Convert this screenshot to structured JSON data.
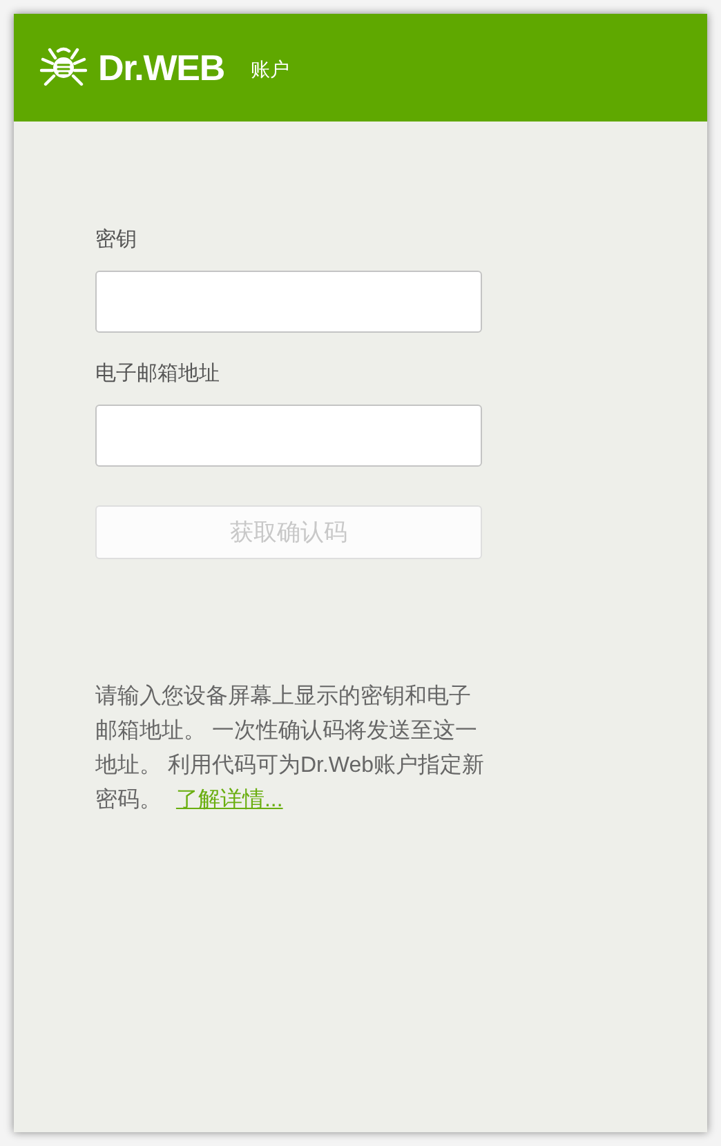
{
  "header": {
    "logo": "Dr.WEB",
    "title": "账户"
  },
  "fields": [
    {
      "label": "密钥"
    },
    {
      "label": "电子邮箱地址"
    }
  ],
  "submit_button": {
    "label": "获取确认码",
    "disabled": true
  },
  "info": {
    "text": "请输入您设备屏幕上显示的密钥和电子邮箱地址。 一次性确认码将发送至这一地址。 利用代码可为Dr.Web账户指定新密码。",
    "link": "了解详情..."
  }
}
